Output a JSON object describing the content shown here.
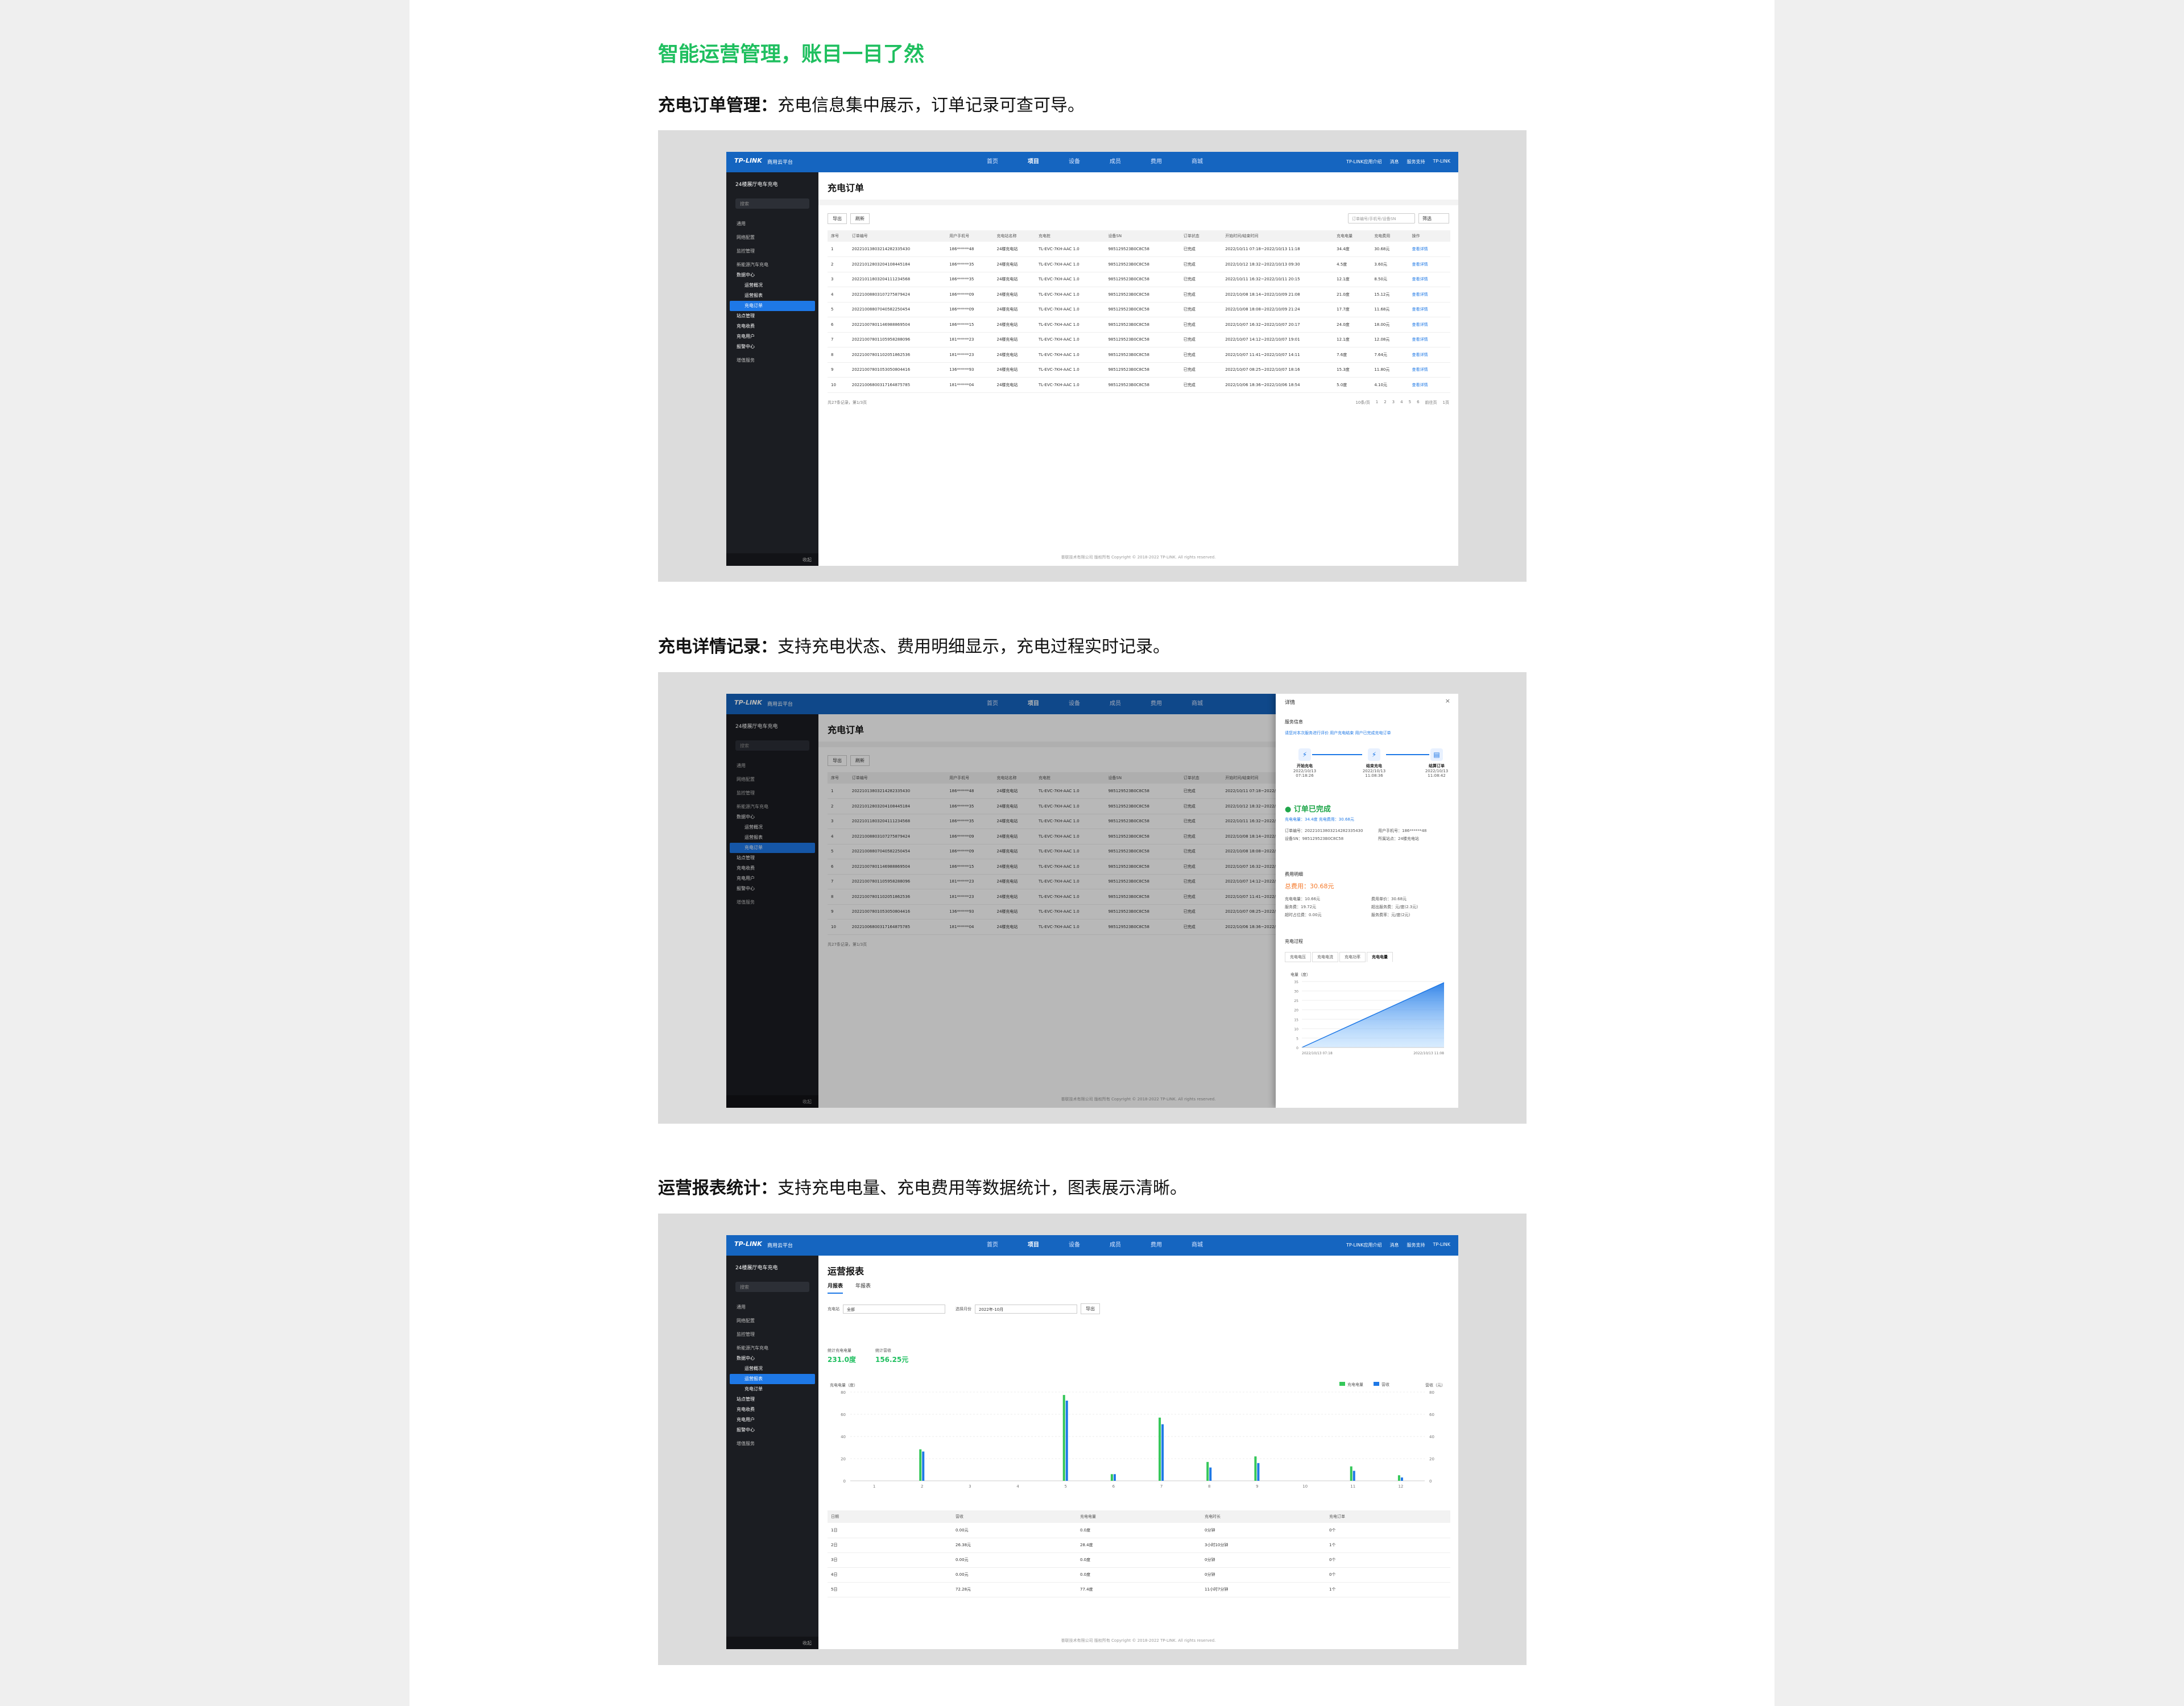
{
  "headline": "智能运营管理，账目一目了然",
  "sections": [
    {
      "title_bold": "充电订单管理：",
      "title_rest": "充电信息集中展示，订单记录可查可导。"
    },
    {
      "title_bold": "充电详情记录：",
      "title_rest": "支持充电状态、费用明细显示，充电过程实时记录。"
    },
    {
      "title_bold": "运营报表统计：",
      "title_rest": "支持充电电量、充电费用等数据统计，图表展示清晰。"
    }
  ],
  "app": {
    "logo": "TP-LINK",
    "platform": "商用云平台",
    "nav": [
      "首页",
      "项目",
      "设备",
      "成员",
      "费用",
      "商城"
    ],
    "nav_active": "项目",
    "top_right": [
      "TP-LINK应用介绍",
      "消息",
      "服务支持",
      "TP-LINK"
    ],
    "site_name": "24楼展厅电车充电",
    "search_placeholder": "搜索",
    "footer_collapse": "收起",
    "copyright": "普联技术有限公司 版权所有 Copyright © 2018-2022 TP-LINK. All rights reserved."
  },
  "sidebar": {
    "groups": [
      {
        "label": "通用",
        "type": "grp"
      },
      {
        "label": "网络配置",
        "type": "grp"
      },
      {
        "label": "监控管理",
        "type": "grp"
      },
      {
        "label": "新能源汽车充电",
        "type": "grp"
      },
      {
        "label": "数据中心",
        "type": "head"
      },
      {
        "label": "运营概况",
        "type": "sub"
      },
      {
        "label": "运营报表",
        "type": "sub"
      },
      {
        "label": "充电订单",
        "type": "sub"
      },
      {
        "label": "站点管理",
        "type": "head"
      },
      {
        "label": "充电收费",
        "type": "head"
      },
      {
        "label": "充电用户",
        "type": "head"
      },
      {
        "label": "报警中心",
        "type": "head"
      },
      {
        "label": "增值服务",
        "type": "grp"
      }
    ]
  },
  "orders": {
    "title": "充电订单",
    "btn_export": "导出",
    "btn_refresh": "刷新",
    "search_placeholder": "订单编号/手机号/设备SN",
    "filter": "筛选",
    "columns": [
      "序号",
      "订单编号",
      "用户手机号",
      "充电站名称",
      "充电桩",
      "设备SN",
      "订单状态",
      "开始时间/结束时间",
      "充电电量",
      "充电费用",
      "操作"
    ],
    "rows": [
      [
        "1",
        "20221013803214282335430",
        "186******48",
        "24楼充电站",
        "TL-EVC-7KH-AAC 1.0",
        "985129523B0C8C58",
        "已完成",
        "2022/10/11 07:18~2022/10/13 11:18",
        "34.4度",
        "30.68元",
        "查看详情"
      ],
      [
        "2",
        "20221012803204108445184",
        "186******35",
        "24楼充电站",
        "TL-EVC-7KH-AAC 1.0",
        "985129523B0C8C58",
        "已完成",
        "2022/10/12 18:32~2022/10/13 09:30",
        "4.5度",
        "3.60元",
        "查看详情"
      ],
      [
        "3",
        "20221011803204111234568",
        "186******35",
        "24楼充电站",
        "TL-EVC-7KH-AAC 1.0",
        "985129523B0C8C58",
        "已完成",
        "2022/10/11 16:32~2022/10/11 20:15",
        "12.1度",
        "8.50元",
        "查看详情"
      ],
      [
        "4",
        "20221008803107275879424",
        "186******09",
        "24楼充电站",
        "TL-EVC-7KH-AAC 1.0",
        "985129523B0C8C58",
        "已完成",
        "2022/10/08 18:14~2022/10/09 21:08",
        "21.0度",
        "15.12元",
        "查看详情"
      ],
      [
        "5",
        "20221008807040582250454",
        "186******09",
        "24楼充电站",
        "TL-EVC-7KH-AAC 1.0",
        "985129523B0C8C58",
        "已完成",
        "2022/10/08 18:08~2022/10/09 21:24",
        "17.7度",
        "11.68元",
        "查看详情"
      ],
      [
        "6",
        "20221007801146988869504",
        "186******15",
        "24楼充电站",
        "TL-EVC-7KH-AAC 1.0",
        "985129523B0C8C58",
        "已完成",
        "2022/10/07 16:32~2022/10/07 20:17",
        "24.0度",
        "18.00元",
        "查看详情"
      ],
      [
        "7",
        "20221007801105958288096",
        "181******23",
        "24楼充电站",
        "TL-EVC-7KH-AAC 1.0",
        "985129523B0C8C58",
        "已完成",
        "2022/10/07 14:12~2022/10/07 19:01",
        "12.1度",
        "12.08元",
        "查看详情"
      ],
      [
        "8",
        "20221007801102051862536",
        "181******23",
        "24楼充电站",
        "TL-EVC-7KH-AAC 1.0",
        "985129523B0C8C58",
        "已完成",
        "2022/10/07 11:41~2022/10/07 14:11",
        "7.6度",
        "7.64元",
        "查看详情"
      ],
      [
        "9",
        "20221007801053050804416",
        "136******93",
        "24楼充电站",
        "TL-EVC-7KH-AAC 1.0",
        "985129523B0C8C58",
        "已完成",
        "2022/10/07 08:25~2022/10/07 18:16",
        "15.3度",
        "11.80元",
        "查看详情"
      ],
      [
        "10",
        "20221006800317164875785",
        "181******04",
        "24楼充电站",
        "TL-EVC-7KH-AAC 1.0",
        "985129523B0C8C58",
        "已完成",
        "2022/10/06 18:36~2022/10/06 18:54",
        "5.0度",
        "4.10元",
        "查看详情"
      ]
    ],
    "pager_total": "共27条记录，第1/3页",
    "page_size": "10条/页",
    "pages": [
      "1",
      "2",
      "3",
      "4",
      "5",
      "6"
    ],
    "jump_label": "前往页",
    "jump_value": "1页"
  },
  "detail": {
    "title": "详情",
    "close": "×",
    "section_msg": "服务信息",
    "tags": "请您对本次服务进行评价 用户充电结束 用户已完成充电订单",
    "steps": [
      {
        "name": "开始充电",
        "time": "2022/10/13 07:18:26"
      },
      {
        "name": "结束充电",
        "time": "2022/10/13 11:08:36"
      },
      {
        "name": "结算订单",
        "time": "2022/10/13 11:08:42"
      }
    ],
    "status": "订单已完成",
    "summary": "充电电量：34.4度  充电费用：30.68元",
    "order_no_label": "订单编号：20221013803214282335430",
    "phone_label": "用户手机号：186******48",
    "device_label": "设备SN：985129523B0C8C58",
    "station_label": "所属站点：24楼充电站",
    "fee_section": "费用明细",
    "fee_total": "总费用：30.68元",
    "fee_items": [
      "充电电量：10.66元",
      "服务费：19.72元",
      "超时占位费：0.00元",
      "费用单价：30.68元",
      "超出服务费：元/度(2.3元)",
      "服务费率：元/度(2元)"
    ],
    "curve_section": "充电过程",
    "curve_tabs": [
      "充电电压",
      "充电电流",
      "充电功率",
      "充电电量"
    ],
    "curve_active": "充电电量",
    "y_label": "电量（度）",
    "x_start": "2022/10/13 07:18",
    "x_end": "2022/10/13 11:08",
    "y_ticks": [
      "35",
      "30",
      "25",
      "20",
      "15",
      "10",
      "5",
      "0"
    ]
  },
  "report": {
    "title": "运营报表",
    "tabs": [
      "月报表",
      "年报表"
    ],
    "tab_active": "月报表",
    "filter_station_label": "充电站",
    "filter_station_value": "全部",
    "filter_month_label": "选择月份",
    "filter_month_value": "2022年-10月",
    "btn_export": "导出",
    "stat1_label": "统计充电电量",
    "stat1_value": "231.0度",
    "stat2_label": "统计营收",
    "stat2_value": "156.25元",
    "columns": [
      "日期",
      "营收",
      "充电电量",
      "充电时长",
      "充电订单"
    ],
    "rows": [
      [
        "1日",
        "0.00元",
        "0.0度",
        "0分钟",
        "0个"
      ],
      [
        "2日",
        "26.38元",
        "28.4度",
        "3小时10分钟",
        "1个"
      ],
      [
        "3日",
        "0.00元",
        "0.0度",
        "0分钟",
        "0个"
      ],
      [
        "4日",
        "0.00元",
        "0.0度",
        "0分钟",
        "0个"
      ],
      [
        "5日",
        "72.28元",
        "77.4度",
        "11小时7分钟",
        "1个"
      ]
    ]
  },
  "chart_data": {
    "type": "bar",
    "ylabel_left": "充电电量（度）",
    "ylabel_right": "营收（元）",
    "legend": [
      "充电电量",
      "营收"
    ],
    "legend_position": "top-right",
    "categories": [
      "1",
      "2",
      "3",
      "4",
      "5",
      "6",
      "7",
      "8",
      "9",
      "10",
      "11",
      "12"
    ],
    "ylim": [
      0,
      80
    ],
    "y_ticks": [
      0,
      20,
      40,
      60,
      80
    ],
    "series": [
      {
        "name": "充电电量",
        "color": "#34c759",
        "values": [
          0,
          28.4,
          0,
          0,
          77.4,
          6,
          57,
          17,
          22,
          0,
          13,
          5
        ]
      },
      {
        "name": "营收",
        "color": "#1e78e6",
        "values": [
          0,
          26.4,
          0,
          0,
          72.3,
          6,
          51,
          12,
          16,
          0,
          9,
          3
        ]
      }
    ]
  },
  "detail_chart": {
    "type": "area",
    "x": [
      "2022/10/13 07:18",
      "2022/10/13 11:08"
    ],
    "y": [
      0,
      34.4
    ],
    "ylim": [
      0,
      35
    ]
  }
}
